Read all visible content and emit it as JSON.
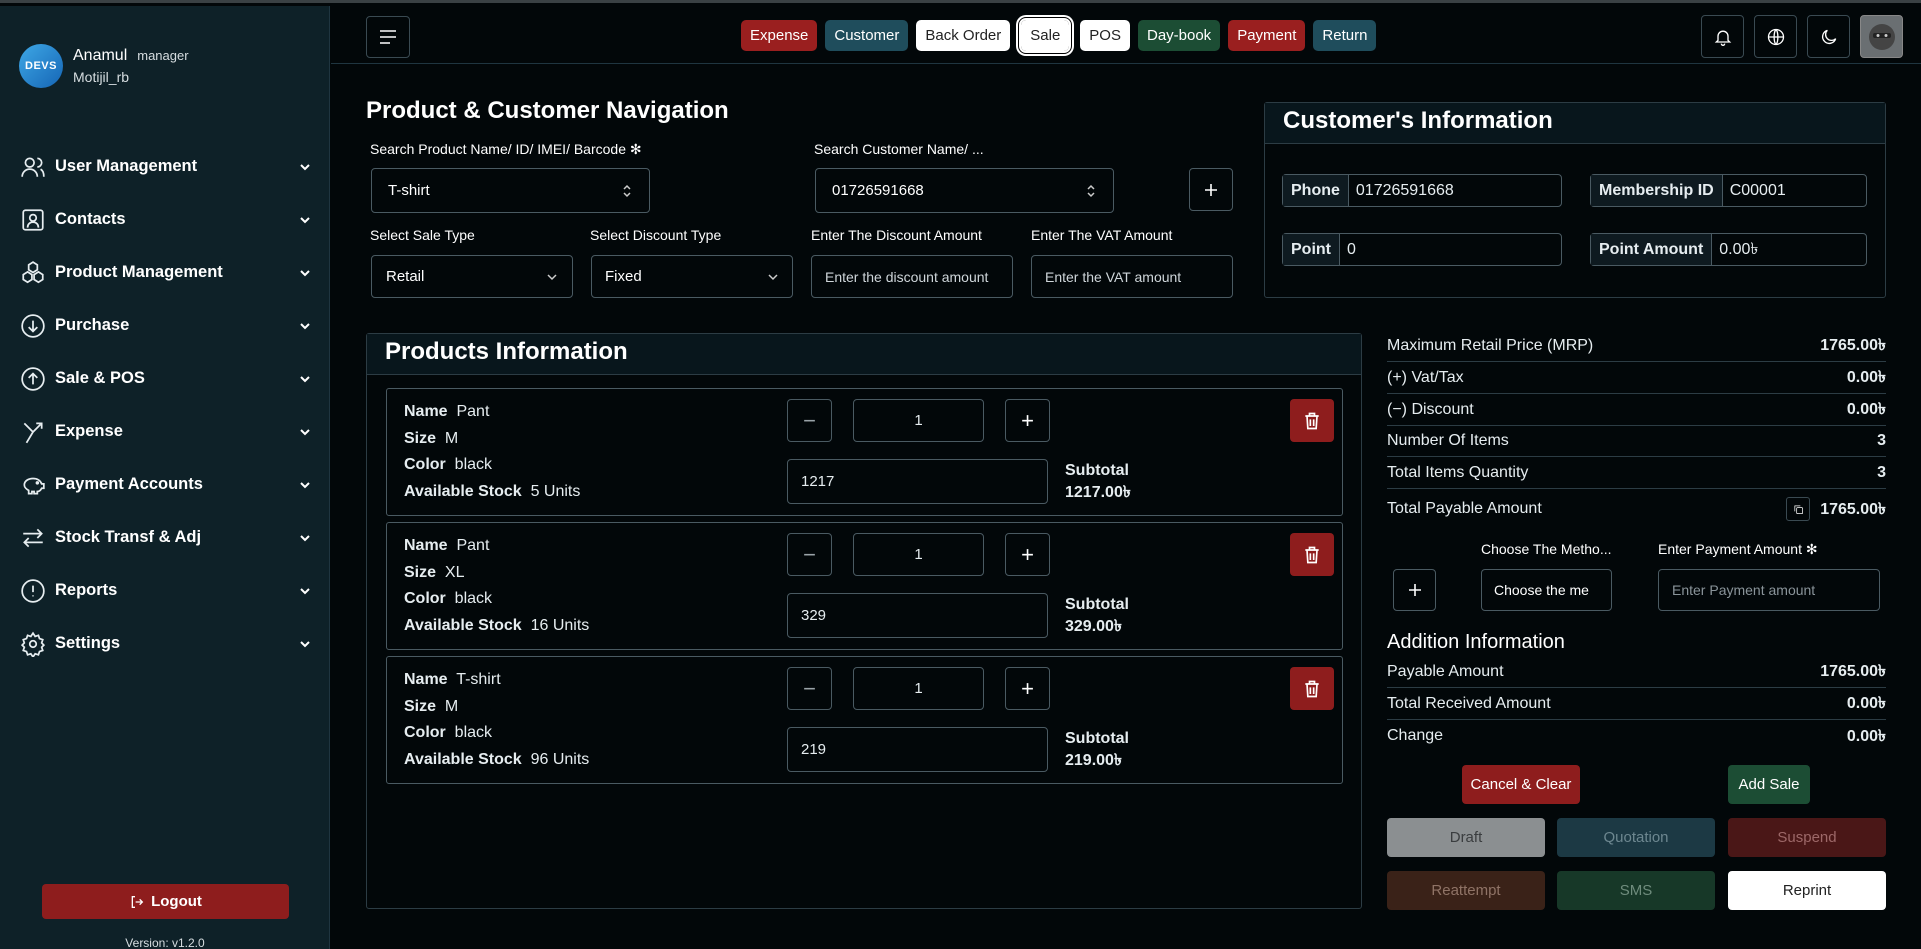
{
  "user": {
    "initials": "DEVS",
    "name": "Anamul",
    "role": "manager",
    "shop": "Motijil_rb"
  },
  "nav": [
    {
      "label": "User Management",
      "icon": "users-icon"
    },
    {
      "label": "Contacts",
      "icon": "contacts-icon"
    },
    {
      "label": "Product Management",
      "icon": "products-icon"
    },
    {
      "label": "Purchase",
      "icon": "purchase-icon"
    },
    {
      "label": "Sale & POS",
      "icon": "sale-icon"
    },
    {
      "label": "Expense",
      "icon": "expense-icon"
    },
    {
      "label": "Payment Accounts",
      "icon": "piggy-bank-icon"
    },
    {
      "label": "Stock Transf & Adj",
      "icon": "transfer-icon"
    },
    {
      "label": "Reports",
      "icon": "reports-icon"
    },
    {
      "label": "Settings",
      "icon": "settings-icon"
    }
  ],
  "logout_label": "Logout",
  "version": "Version: v1.2.0",
  "quick_links": [
    "Expense",
    "Customer",
    "Back Order",
    "Sale",
    "POS",
    "Day-book",
    "Payment",
    "Return"
  ],
  "nav_section": {
    "title": "Product & Customer Navigation",
    "product_search_label": "Search Product Name/ ID/ IMEI/ Barcode ✻",
    "product_search_value": "T-shirt",
    "customer_search_label": "Search Customer Name/ ...",
    "customer_search_value": "01726591668",
    "sale_type_label": "Select Sale Type",
    "sale_type_value": "Retail",
    "discount_type_label": "Select Discount Type",
    "discount_type_value": "Fixed",
    "discount_amount_label": "Enter The Discount Amount",
    "discount_amount_placeholder": "Enter the discount amount",
    "vat_label": "Enter The VAT Amount",
    "vat_placeholder": "Enter the VAT amount"
  },
  "customer_info": {
    "title": "Customer's Information",
    "phone_label": "Phone",
    "phone": "01726591668",
    "membership_label": "Membership ID",
    "membership": "C00001",
    "point_label": "Point",
    "point": "0",
    "point_amount_label": "Point Amount",
    "point_amount": "0.00৳"
  },
  "products_title": "Products Information",
  "products": [
    {
      "name": "Pant",
      "size": "M",
      "color": "black",
      "stock": "5 Units",
      "qty": "1",
      "price": "1217",
      "subtotal": "1217.00৳"
    },
    {
      "name": "Pant",
      "size": "XL",
      "color": "black",
      "stock": "16 Units",
      "qty": "1",
      "price": "329",
      "subtotal": "329.00৳"
    },
    {
      "name": "T-shirt",
      "size": "M",
      "color": "black",
      "stock": "96 Units",
      "qty": "1",
      "price": "219",
      "subtotal": "219.00৳"
    }
  ],
  "labels": {
    "name": "Name",
    "size": "Size",
    "color": "Color",
    "stock": "Available Stock",
    "subtotal": "Subtotal"
  },
  "summary": [
    {
      "label": "Maximum Retail Price (MRP)",
      "value": "1765.00৳"
    },
    {
      "label": "(+) Vat/Tax",
      "value": "0.00৳"
    },
    {
      "label": "(−) Discount",
      "value": "0.00৳"
    },
    {
      "label": "Number Of Items",
      "value": "3"
    },
    {
      "label": "Total Items Quantity",
      "value": "3"
    },
    {
      "label": "Total Payable Amount",
      "value": "1765.00৳"
    }
  ],
  "payment": {
    "method_label": "Choose The Metho...",
    "method_value": "Choose the me",
    "amount_label": "Enter Payment Amount ✻",
    "amount_placeholder": "Enter Payment amount"
  },
  "addition": {
    "title": "Addition Information",
    "rows": [
      {
        "label": "Payable Amount",
        "value": "1765.00৳"
      },
      {
        "label": "Total Received Amount",
        "value": "0.00৳"
      },
      {
        "label": "Change",
        "value": "0.00৳"
      }
    ]
  },
  "buttons": {
    "cancel": "Cancel & Clear",
    "add_sale": "Add Sale",
    "draft": "Draft",
    "quotation": "Quotation",
    "suspend": "Suspend",
    "reattempt": "Reattempt",
    "sms": "SMS",
    "reprint": "Reprint"
  }
}
